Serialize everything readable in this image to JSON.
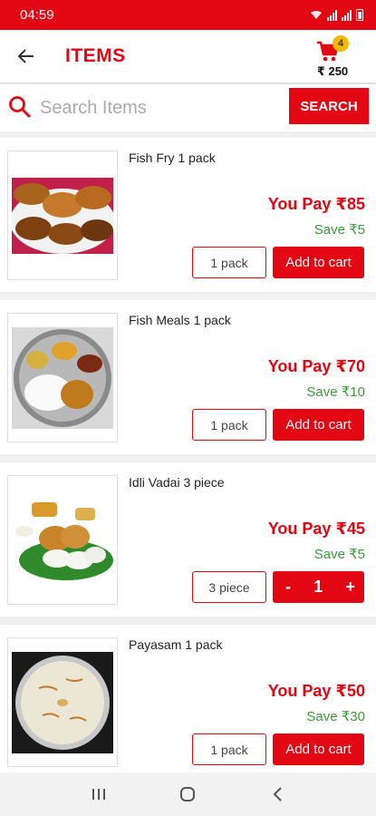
{
  "status_bar": {
    "time": "04:59"
  },
  "header": {
    "title": "ITEMS",
    "cart_count": "4",
    "cart_total": "₹ 250"
  },
  "search": {
    "placeholder": "Search Items",
    "button_label": "SEARCH"
  },
  "products": [
    {
      "name": "Fish Fry 1 pack",
      "pay": "You Pay ₹85",
      "save": "Save ₹5",
      "unit": "1 pack",
      "action": "Add to cart",
      "image": "fish-fry"
    },
    {
      "name": "Fish Meals 1 pack",
      "pay": "You Pay ₹70",
      "save": "Save ₹10",
      "unit": "1 pack",
      "action": "Add to cart",
      "image": "fish-meals"
    },
    {
      "name": "Idli Vadai 3 piece",
      "pay": "You Pay ₹45",
      "save": "Save ₹5",
      "unit": "3 piece",
      "qty_minus": "-",
      "qty": "1",
      "qty_plus": "+",
      "image": "idli-vadai"
    },
    {
      "name": "Payasam 1 pack",
      "pay": "You Pay ₹50",
      "save": "Save ₹30",
      "unit": "1 pack",
      "action": "Add to cart",
      "image": "payasam"
    }
  ],
  "colors": {
    "brand": "#e30613",
    "save_green": "#3a9a3a",
    "badge": "#f5b800"
  },
  "icons": [
    "back-arrow-icon",
    "cart-icon",
    "search-icon",
    "recent-apps-icon",
    "home-icon",
    "back-nav-icon"
  ]
}
